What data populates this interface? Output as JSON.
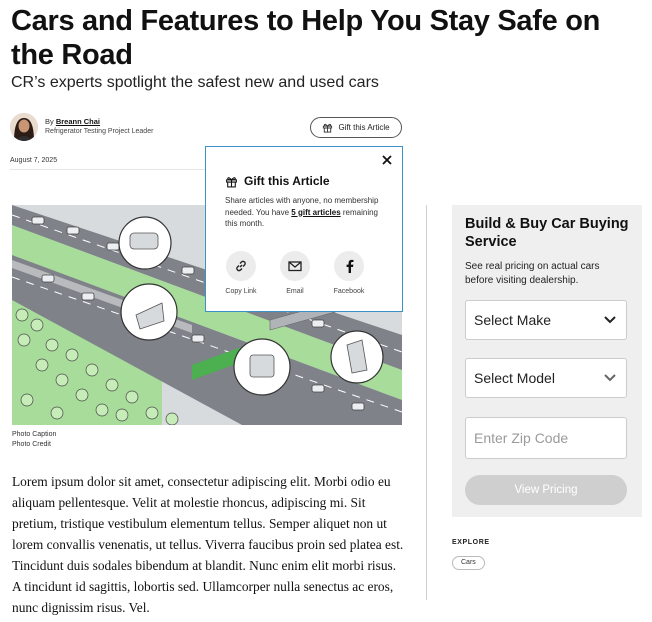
{
  "article": {
    "title": "Cars and Features to Help You Stay Safe on the Road",
    "subtitle": "CR’s experts spotlight the safest new and used cars",
    "author_prefix": "By ",
    "author": "Breann Chai",
    "author_role": "Refrigerator Testing Project Leader",
    "date": "August 7, 2025",
    "gift_button": "Gift this Article",
    "photo_caption": "Photo Caption",
    "photo_credit": "Photo Credit",
    "body": "Lorem ipsum dolor sit amet, consectetur adipiscing elit. Morbi odio eu aliquam pellentesque. Velit at molestie rhoncus, adipiscing mi. Sit pretium, tristique vestibulum elementum tellus. Semper aliquet non ut lorem convallis venenatis, ut tellus. Viverra faucibus proin sed platea est. Tincidunt duis sodales bibendum at blandit. Nunc enim elit morbi risus. A tincidunt id sagittis, lobortis sed. Ullamcorper nulla senectus ac eros, nunc dignissim risus. Vel."
  },
  "gift_popover": {
    "title": "Gift this Article",
    "text_before": "Share articles with anyone, no membership needed. You have ",
    "count_link": "5 gift articles",
    "text_after": " remaining this month.",
    "options": [
      {
        "label": "Copy Link",
        "icon": "link-icon"
      },
      {
        "label": "Email",
        "icon": "mail-icon"
      },
      {
        "label": "Facebook",
        "icon": "facebook-icon"
      }
    ]
  },
  "pricing": {
    "title": "Build & Buy Car Buying Service",
    "description": "See real pricing on actual cars before visiting dealership.",
    "make_label": "Select Make",
    "model_label": "Select Model",
    "zip_placeholder": "Enter Zip Code",
    "button": "View Pricing"
  },
  "explore": {
    "heading": "EXPLORE",
    "tags": [
      "Cars"
    ]
  },
  "colors": {
    "accent_border": "#3a92c6",
    "road": "#7f8389",
    "grass": "#a8dc9a",
    "button_disabled": "#cfcfcf"
  }
}
